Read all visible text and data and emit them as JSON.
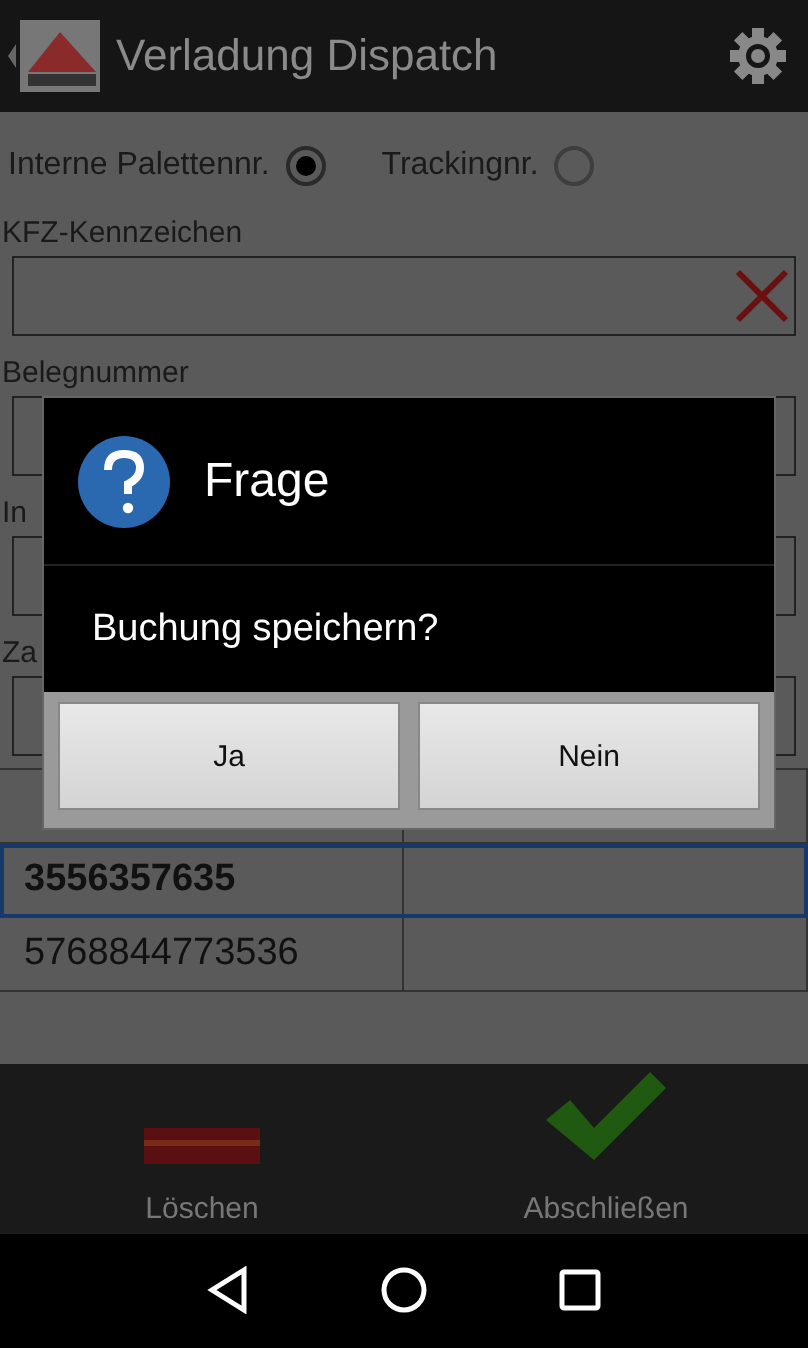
{
  "app_bar": {
    "title": "Verladung Dispatch"
  },
  "mode_options": [
    {
      "label": "Interne Palettennr.",
      "selected": true
    },
    {
      "label": "Trackingnr.",
      "selected": false
    }
  ],
  "fields": [
    {
      "label": "KFZ-Kennzeichen",
      "clearable": true
    },
    {
      "label": "Belegnummer",
      "clearable": false
    },
    {
      "label": "In",
      "clearable": false
    },
    {
      "label": "Za",
      "clearable": false
    }
  ],
  "table": {
    "rows": [
      {
        "tracking": "3556357635",
        "selected": true
      },
      {
        "tracking": "5768844773536",
        "selected": false
      }
    ]
  },
  "actions": [
    {
      "label": "Löschen",
      "kind": "delete"
    },
    {
      "label": "Abschließen",
      "kind": "confirm"
    }
  ],
  "dialog": {
    "title": "Frage",
    "message": "Buchung speichern?",
    "buttons": [
      "Ja",
      "Nein"
    ]
  }
}
